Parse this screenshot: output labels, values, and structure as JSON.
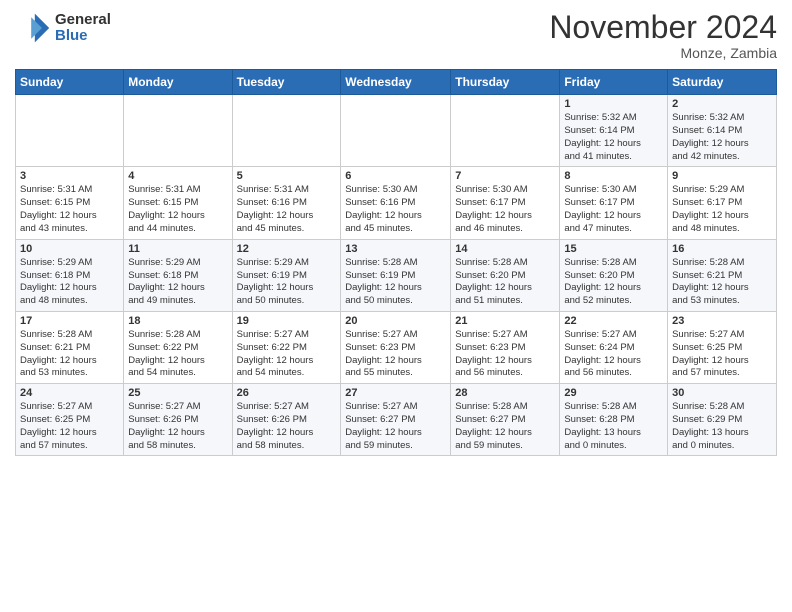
{
  "logo": {
    "general": "General",
    "blue": "Blue"
  },
  "title": {
    "month": "November 2024",
    "location": "Monze, Zambia"
  },
  "weekdays": [
    "Sunday",
    "Monday",
    "Tuesday",
    "Wednesday",
    "Thursday",
    "Friday",
    "Saturday"
  ],
  "weeks": [
    [
      {
        "day": "",
        "info": ""
      },
      {
        "day": "",
        "info": ""
      },
      {
        "day": "",
        "info": ""
      },
      {
        "day": "",
        "info": ""
      },
      {
        "day": "",
        "info": ""
      },
      {
        "day": "1",
        "info": "Sunrise: 5:32 AM\nSunset: 6:14 PM\nDaylight: 12 hours\nand 41 minutes."
      },
      {
        "day": "2",
        "info": "Sunrise: 5:32 AM\nSunset: 6:14 PM\nDaylight: 12 hours\nand 42 minutes."
      }
    ],
    [
      {
        "day": "3",
        "info": "Sunrise: 5:31 AM\nSunset: 6:15 PM\nDaylight: 12 hours\nand 43 minutes."
      },
      {
        "day": "4",
        "info": "Sunrise: 5:31 AM\nSunset: 6:15 PM\nDaylight: 12 hours\nand 44 minutes."
      },
      {
        "day": "5",
        "info": "Sunrise: 5:31 AM\nSunset: 6:16 PM\nDaylight: 12 hours\nand 45 minutes."
      },
      {
        "day": "6",
        "info": "Sunrise: 5:30 AM\nSunset: 6:16 PM\nDaylight: 12 hours\nand 45 minutes."
      },
      {
        "day": "7",
        "info": "Sunrise: 5:30 AM\nSunset: 6:17 PM\nDaylight: 12 hours\nand 46 minutes."
      },
      {
        "day": "8",
        "info": "Sunrise: 5:30 AM\nSunset: 6:17 PM\nDaylight: 12 hours\nand 47 minutes."
      },
      {
        "day": "9",
        "info": "Sunrise: 5:29 AM\nSunset: 6:17 PM\nDaylight: 12 hours\nand 48 minutes."
      }
    ],
    [
      {
        "day": "10",
        "info": "Sunrise: 5:29 AM\nSunset: 6:18 PM\nDaylight: 12 hours\nand 48 minutes."
      },
      {
        "day": "11",
        "info": "Sunrise: 5:29 AM\nSunset: 6:18 PM\nDaylight: 12 hours\nand 49 minutes."
      },
      {
        "day": "12",
        "info": "Sunrise: 5:29 AM\nSunset: 6:19 PM\nDaylight: 12 hours\nand 50 minutes."
      },
      {
        "day": "13",
        "info": "Sunrise: 5:28 AM\nSunset: 6:19 PM\nDaylight: 12 hours\nand 50 minutes."
      },
      {
        "day": "14",
        "info": "Sunrise: 5:28 AM\nSunset: 6:20 PM\nDaylight: 12 hours\nand 51 minutes."
      },
      {
        "day": "15",
        "info": "Sunrise: 5:28 AM\nSunset: 6:20 PM\nDaylight: 12 hours\nand 52 minutes."
      },
      {
        "day": "16",
        "info": "Sunrise: 5:28 AM\nSunset: 6:21 PM\nDaylight: 12 hours\nand 53 minutes."
      }
    ],
    [
      {
        "day": "17",
        "info": "Sunrise: 5:28 AM\nSunset: 6:21 PM\nDaylight: 12 hours\nand 53 minutes."
      },
      {
        "day": "18",
        "info": "Sunrise: 5:28 AM\nSunset: 6:22 PM\nDaylight: 12 hours\nand 54 minutes."
      },
      {
        "day": "19",
        "info": "Sunrise: 5:27 AM\nSunset: 6:22 PM\nDaylight: 12 hours\nand 54 minutes."
      },
      {
        "day": "20",
        "info": "Sunrise: 5:27 AM\nSunset: 6:23 PM\nDaylight: 12 hours\nand 55 minutes."
      },
      {
        "day": "21",
        "info": "Sunrise: 5:27 AM\nSunset: 6:23 PM\nDaylight: 12 hours\nand 56 minutes."
      },
      {
        "day": "22",
        "info": "Sunrise: 5:27 AM\nSunset: 6:24 PM\nDaylight: 12 hours\nand 56 minutes."
      },
      {
        "day": "23",
        "info": "Sunrise: 5:27 AM\nSunset: 6:25 PM\nDaylight: 12 hours\nand 57 minutes."
      }
    ],
    [
      {
        "day": "24",
        "info": "Sunrise: 5:27 AM\nSunset: 6:25 PM\nDaylight: 12 hours\nand 57 minutes."
      },
      {
        "day": "25",
        "info": "Sunrise: 5:27 AM\nSunset: 6:26 PM\nDaylight: 12 hours\nand 58 minutes."
      },
      {
        "day": "26",
        "info": "Sunrise: 5:27 AM\nSunset: 6:26 PM\nDaylight: 12 hours\nand 58 minutes."
      },
      {
        "day": "27",
        "info": "Sunrise: 5:27 AM\nSunset: 6:27 PM\nDaylight: 12 hours\nand 59 minutes."
      },
      {
        "day": "28",
        "info": "Sunrise: 5:28 AM\nSunset: 6:27 PM\nDaylight: 12 hours\nand 59 minutes."
      },
      {
        "day": "29",
        "info": "Sunrise: 5:28 AM\nSunset: 6:28 PM\nDaylight: 13 hours\nand 0 minutes."
      },
      {
        "day": "30",
        "info": "Sunrise: 5:28 AM\nSunset: 6:29 PM\nDaylight: 13 hours\nand 0 minutes."
      }
    ]
  ]
}
